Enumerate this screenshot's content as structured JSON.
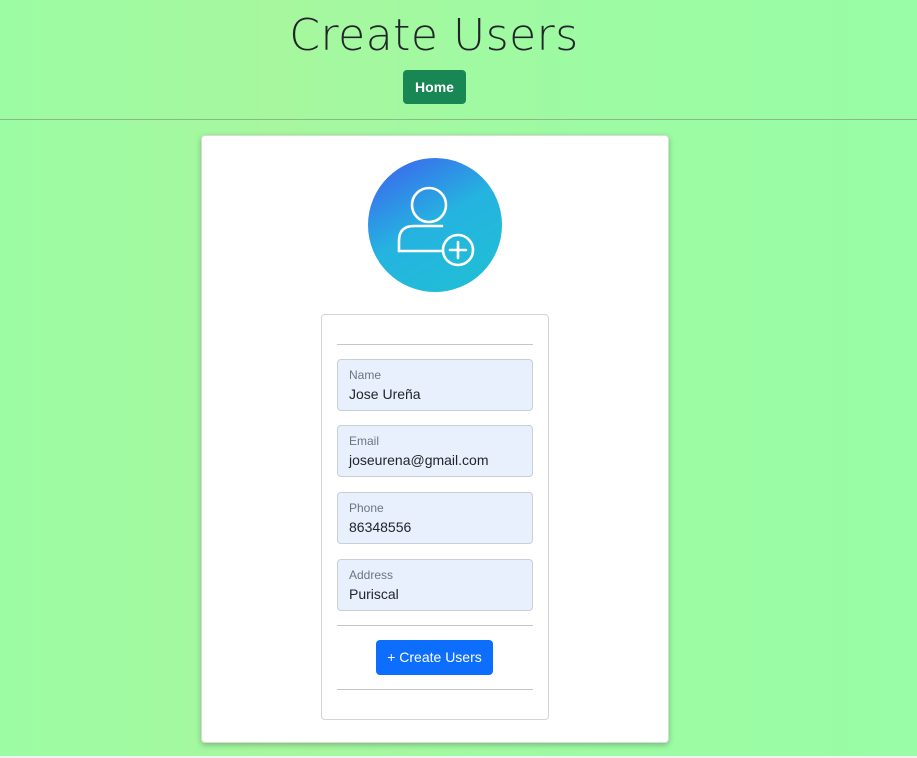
{
  "header": {
    "title": "Create Users",
    "home_label": "Home"
  },
  "avatar": {
    "icon": "add-user-icon"
  },
  "form": {
    "fields": [
      {
        "label": "Name",
        "value": "Jose Ureña"
      },
      {
        "label": "Email",
        "value": "joseurena@gmail.com"
      },
      {
        "label": "Phone",
        "value": "86348556"
      },
      {
        "label": "Address",
        "value": "Puriscal"
      }
    ],
    "submit_label": "+ Create Users"
  },
  "colors": {
    "background": "#9dfba3",
    "home_button": "#198754",
    "submit_button": "#0d6efd",
    "field_background": "#e8f0fe"
  }
}
